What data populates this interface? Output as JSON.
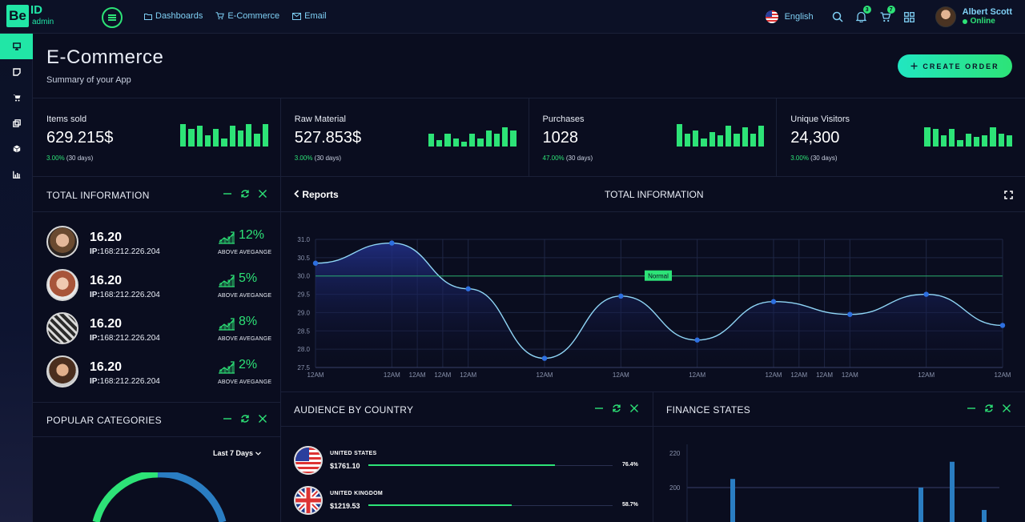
{
  "brand": {
    "logo_letters": "Be",
    "logo_id": "ID",
    "logo_sub": "admin"
  },
  "topnav": [
    {
      "label": "Dashboards",
      "icon": "folder-icon"
    },
    {
      "label": "E-Commerce",
      "icon": "cart-icon"
    },
    {
      "label": "Email",
      "icon": "mail-icon"
    }
  ],
  "header_right": {
    "language": "English",
    "notifications_badge": "3",
    "cart_badge": "7",
    "user_name": "Albert Scott",
    "user_status": "Online"
  },
  "sidebar": {
    "items": [
      "monitor-icon",
      "note-icon",
      "cart-icon",
      "copy-icon",
      "cube-icon",
      "chart-icon"
    ]
  },
  "page": {
    "title": "E-Commerce",
    "subtitle": "Summary of your App",
    "create_button": "CREATE ORDER"
  },
  "stats": [
    {
      "label": "Items sold",
      "value": "629.215$",
      "pct": "3.00%",
      "period": "(30 days)",
      "bars": [
        28,
        22,
        26,
        14,
        22,
        10,
        26,
        20,
        28,
        16,
        28
      ]
    },
    {
      "label": "Raw Material",
      "value": "527.853$",
      "pct": "3.00%",
      "period": "(30 days)",
      "bars": [
        16,
        8,
        16,
        10,
        6,
        16,
        10,
        20,
        16,
        24,
        20
      ]
    },
    {
      "label": "Purchases",
      "value": "1028",
      "pct": "47.00%",
      "period": "(30 days)",
      "bars": [
        28,
        16,
        20,
        10,
        18,
        14,
        26,
        16,
        24,
        16,
        26
      ]
    },
    {
      "label": "Unique Visitors",
      "value": "24,300",
      "pct": "3.00%",
      "period": "(30 days)",
      "bars": [
        24,
        22,
        14,
        22,
        8,
        16,
        12,
        14,
        24,
        16,
        14
      ]
    }
  ],
  "total_info": {
    "title": "TOTAL INFORMATION",
    "rows": [
      {
        "value": "16.20",
        "ip_label": "IP:",
        "ip": "168:212.226.204",
        "pct": "12%",
        "caption": "ABOVE AVEGANGE"
      },
      {
        "value": "16.20",
        "ip_label": "IP:",
        "ip": "168:212.226.204",
        "pct": "5%",
        "caption": "ABOVE AVEGANGE"
      },
      {
        "value": "16.20",
        "ip_label": "IP:",
        "ip": "168:212.226.204",
        "pct": "8%",
        "caption": "ABOVE AVEGANGE"
      },
      {
        "value": "16.20",
        "ip_label": "IP:",
        "ip": "168:212.226.204",
        "pct": "2%",
        "caption": "ABOVE AVEGANGE"
      }
    ]
  },
  "popular": {
    "title": "POPULAR CATEGORIES",
    "period": "Last 7 Days"
  },
  "reports": {
    "back_label": "Reports",
    "title": "TOTAL INFORMATION"
  },
  "audience": {
    "title": "AUDIENCE BY COUNTRY",
    "rows": [
      {
        "country": "UNITED STATES",
        "amount": "$1761.10",
        "pct": "76.4%",
        "fill": 0.764
      },
      {
        "country": "UNITED KINGDOM",
        "amount": "$1219.53",
        "pct": "58.7%",
        "fill": 0.587
      }
    ]
  },
  "finance": {
    "title": "FINANCE STATES"
  },
  "colors": {
    "accent": "#2de377",
    "teal": "#21e6a6",
    "background": "#0a0d1f",
    "line": "#4f7ee0"
  },
  "chart_data": [
    {
      "type": "line",
      "title": "TOTAL INFORMATION",
      "x": [
        0,
        1,
        2,
        3,
        4,
        5,
        6,
        7,
        8,
        9,
        10,
        11,
        12,
        13,
        14,
        15,
        16,
        17,
        18,
        19,
        20,
        21,
        22,
        23,
        24,
        25,
        26,
        27
      ],
      "x_tick_labels": [
        "12AM",
        "12AM",
        "12AM",
        "12AM",
        "12AM",
        "12AM",
        "12AM",
        "12AM",
        "12AM",
        "12AM",
        "12AM",
        "12AM",
        "12AM",
        "12AM"
      ],
      "x_tick_positions": [
        0,
        3,
        4,
        5,
        6,
        9,
        12,
        15,
        18,
        19,
        20,
        21,
        24,
        27
      ],
      "points": [
        {
          "x": 0,
          "y": 30.35
        },
        {
          "x": 3,
          "y": 30.9
        },
        {
          "x": 6,
          "y": 29.65
        },
        {
          "x": 9,
          "y": 27.75
        },
        {
          "x": 12,
          "y": 29.45
        },
        {
          "x": 15,
          "y": 28.25
        },
        {
          "x": 18,
          "y": 29.3
        },
        {
          "x": 21,
          "y": 28.95
        },
        {
          "x": 24,
          "y": 29.5
        },
        {
          "x": 27,
          "y": 28.65
        }
      ],
      "ylim": [
        27.5,
        31.0
      ],
      "yticks": [
        "31.0",
        "30.5",
        "30.0",
        "29.5",
        "29.0",
        "28.5",
        "28.0",
        "27.5"
      ],
      "threshold": {
        "value": 30.0,
        "label": "Normal"
      },
      "grid": true
    },
    {
      "type": "bar",
      "title": "FINANCE STATES",
      "yticks": [
        "220",
        "200"
      ],
      "threshold": 200,
      "values": [
        205,
        200,
        215,
        187
      ]
    }
  ]
}
